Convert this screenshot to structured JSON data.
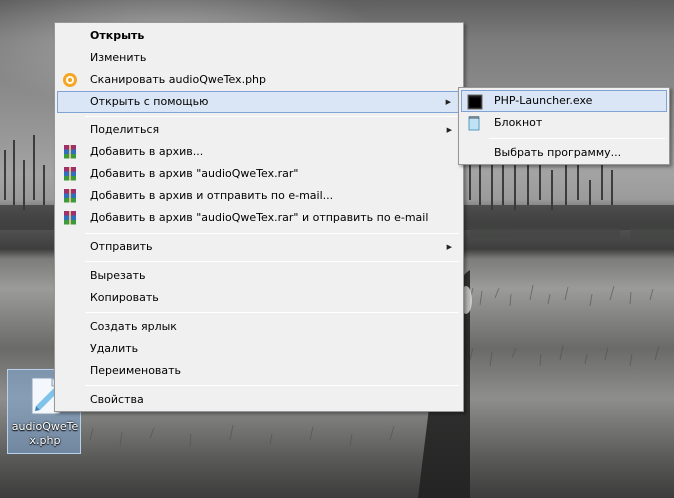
{
  "desktop": {
    "icon_label": "audioQweTex.php"
  },
  "context_menu": {
    "items": [
      {
        "label": "Открыть",
        "bold": true
      },
      {
        "label": "Изменить"
      },
      {
        "label": "Сканировать audioQweTex.php",
        "icon": "antivirus-scan-icon"
      },
      {
        "label": "Открыть с помощью",
        "submenu": true,
        "highlighted": true
      },
      {
        "label": "Поделиться",
        "submenu": true
      },
      {
        "label": "Добавить в архив...",
        "icon": "winrar-icon"
      },
      {
        "label": "Добавить в архив \"audioQweTex.rar\"",
        "icon": "winrar-icon"
      },
      {
        "label": "Добавить в архив и отправить по e-mail...",
        "icon": "winrar-icon"
      },
      {
        "label": "Добавить в архив \"audioQweTex.rar\" и отправить по e-mail",
        "icon": "winrar-icon"
      },
      {
        "label": "Отправить",
        "submenu": true
      },
      {
        "label": "Вырезать"
      },
      {
        "label": "Копировать"
      },
      {
        "label": "Создать ярлык"
      },
      {
        "label": "Удалить"
      },
      {
        "label": "Переименовать"
      },
      {
        "label": "Свойства"
      }
    ]
  },
  "open_with_submenu": {
    "items": [
      {
        "label": "PHP-Launcher.exe",
        "icon": "console-app-icon",
        "highlighted": true
      },
      {
        "label": "Блокнот",
        "icon": "notepad-icon"
      },
      {
        "label": "Выбрать программу..."
      }
    ]
  },
  "colors": {
    "menu_bg": "#f0f0f0",
    "highlight_bg": "#dae6f5",
    "highlight_border": "#7ea3d4",
    "scan_icon": "#f5a623"
  }
}
